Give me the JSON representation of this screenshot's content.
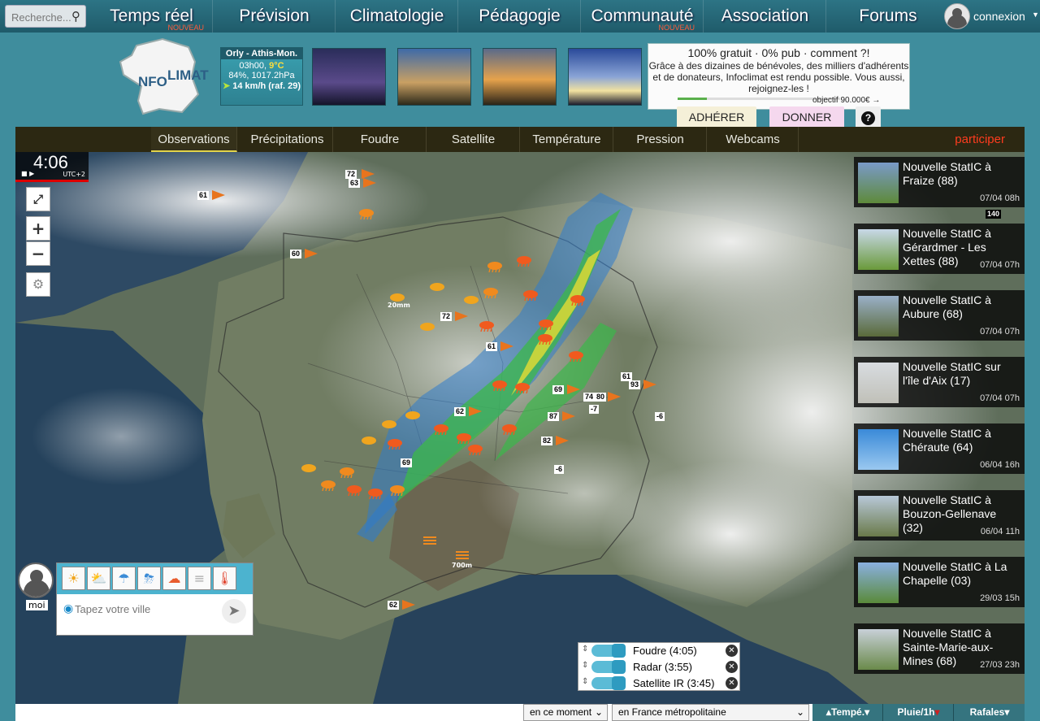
{
  "search": {
    "placeholder": "Recherche..."
  },
  "nav": {
    "items": [
      {
        "label": "Temps réel",
        "badge": "NOUVEAU"
      },
      {
        "label": "Prévision",
        "badge": ""
      },
      {
        "label": "Climatologie",
        "badge": ""
      },
      {
        "label": "Pédagogie",
        "badge": ""
      },
      {
        "label": "Communauté",
        "badge": "NOUVEAU"
      },
      {
        "label": "Association",
        "badge": ""
      },
      {
        "label": "Forums",
        "badge": ""
      }
    ],
    "login": "connexion"
  },
  "logo": {
    "text": "INFO CLIMAT"
  },
  "station": {
    "name": "Orly - Athis-Mon.",
    "time": "03h00",
    "temp": "9°C",
    "humidity_pressure": "84%, 1017.2hPa",
    "wind": "14 km/h (raf. 29)"
  },
  "promo": {
    "headline": "100% gratuit · 0% pub · comment ?!",
    "body": "Grâce à des dizaines de bénévoles, des milliers d'adhérents et de donateurs, Infoclimat est rendu possible. Vous aussi, rejoignez-les !",
    "goal": "objectif 90.000€ →",
    "progress": 0.18,
    "adherer": "ADHÉRER",
    "donner": "DONNER",
    "help": "?"
  },
  "tabs": [
    "Observations",
    "Précipitations",
    "Foudre",
    "Satellite",
    "Température",
    "Pression",
    "Webcams"
  ],
  "active_tab": "Observations",
  "participer": "participer",
  "clock": {
    "time": "4:06",
    "tz": "UTC+2"
  },
  "map": {
    "labels": [
      "72",
      "63",
      "61",
      "60",
      "72",
      "61",
      "62",
      "69",
      "74",
      "80",
      "61",
      "93",
      "87",
      "82",
      "-6",
      "-7",
      "-6",
      "69",
      "62",
      "20mm",
      "700m",
      "140"
    ]
  },
  "me": {
    "label": "moi"
  },
  "city_input": {
    "placeholder": "Tapez votre ville"
  },
  "layers": [
    {
      "name": "Foudre (4:05)"
    },
    {
      "name": "Radar (3:55)"
    },
    {
      "name": "Satellite IR (3:45)"
    }
  ],
  "news": [
    {
      "title": "Nouvelle StatIC à Fraize (88)",
      "date": "07/04 08h"
    },
    {
      "title": "Nouvelle StatIC à Gérardmer - Les Xettes (88)",
      "date": "07/04 07h"
    },
    {
      "title": "Nouvelle StatIC à Aubure (68)",
      "date": "07/04 07h"
    },
    {
      "title": "Nouvelle StatIC sur l'île d'Aix (17)",
      "date": "07/04 07h"
    },
    {
      "title": "Nouvelle StatIC à Chéraute (64)",
      "date": "06/04 16h"
    },
    {
      "title": "Nouvelle StatIC à Bouzon-Gellenave (32)",
      "date": "06/04 11h"
    },
    {
      "title": "Nouvelle StatIC à La Chapelle (03)",
      "date": "29/03 15h"
    },
    {
      "title": "Nouvelle StatIC à Sainte-Marie-aux-Mines (68)",
      "date": "27/03 23h"
    }
  ],
  "bottom": {
    "moment": "en ce moment",
    "region": "en France métropolitaine",
    "tempe": "Tempé.",
    "pluie": "Pluie/1h",
    "rafales": "Rafales"
  }
}
